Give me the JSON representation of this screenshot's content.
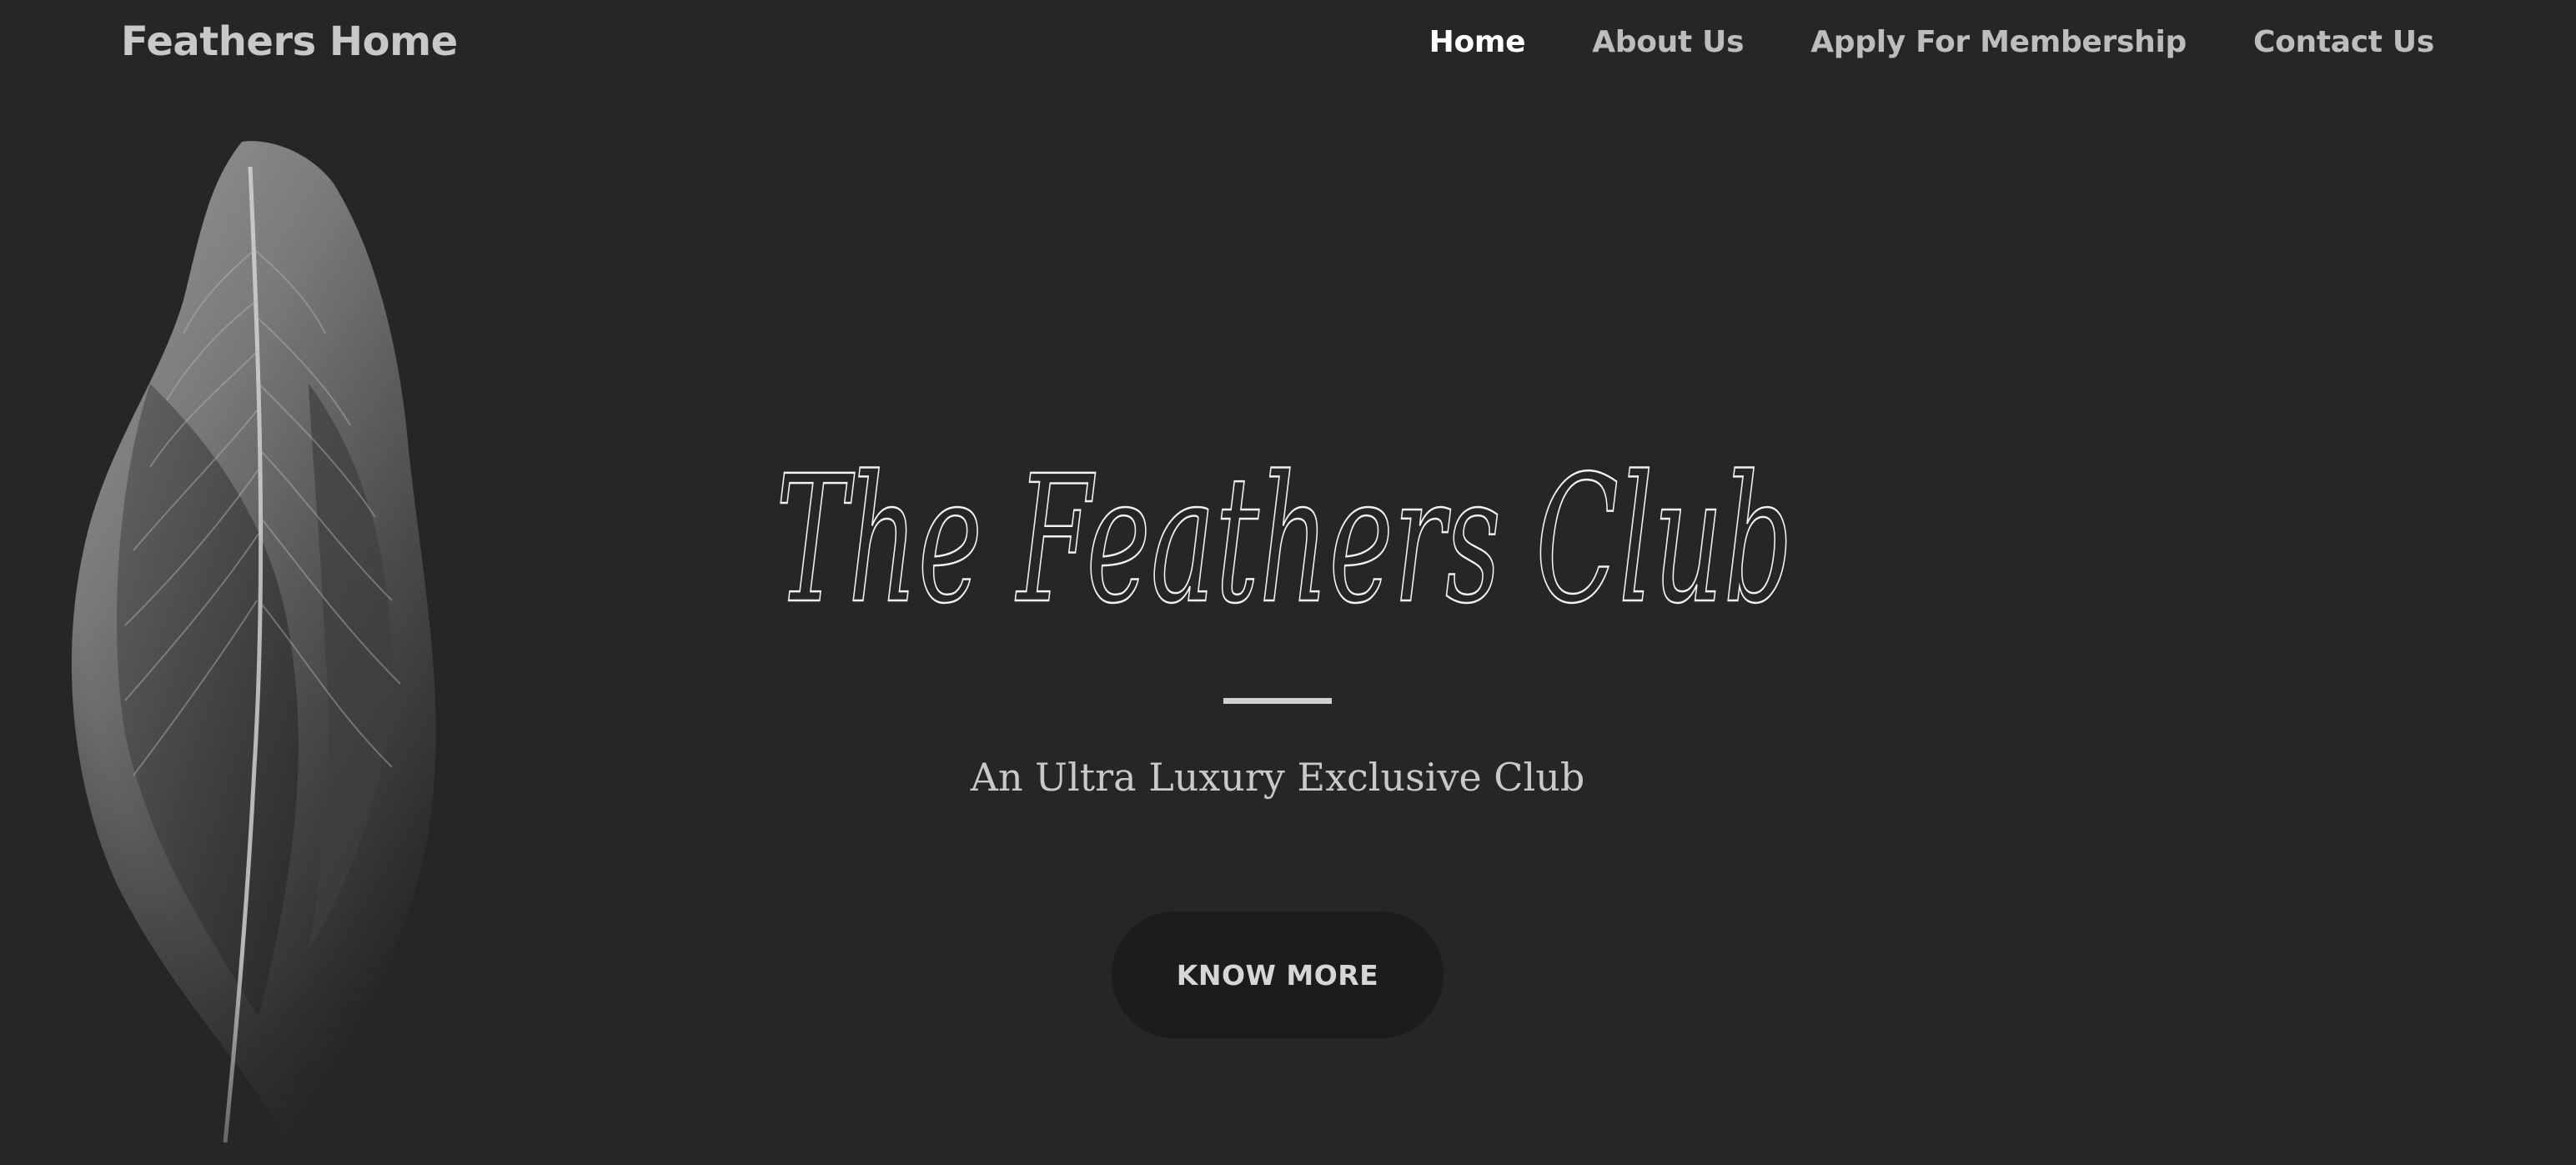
{
  "navbar": {
    "brand": "Feathers Home",
    "links": [
      {
        "label": "Home",
        "active": true
      },
      {
        "label": "About Us",
        "active": false
      },
      {
        "label": "Apply For Membership",
        "active": false
      },
      {
        "label": "Contact Us",
        "active": false
      }
    ]
  },
  "hero": {
    "title": "The Feathers Club",
    "subtitle": "An Ultra Luxury Exclusive Club",
    "cta_label": "KNOW MORE"
  },
  "colors": {
    "background": "#262626",
    "nav_text": "#bdbdbd",
    "nav_active": "#ffffff",
    "button_bg": "#1c1c1c"
  },
  "icons": {
    "feather_image": "feather-image"
  }
}
